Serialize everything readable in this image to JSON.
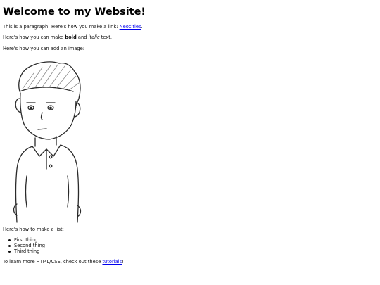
{
  "title": "Welcome to my Website!",
  "intro": {
    "before": "This is a paragraph! Here's how you make a link: ",
    "link": "Neocities",
    "after": "."
  },
  "formatting": {
    "before": "Here's how you can make ",
    "bold": "bold",
    "middle": " and ",
    "italic": "italic",
    "after": " text."
  },
  "image_intro": "Here's how you can add an image:",
  "image": {
    "alt": "cartoon-boy-drawing"
  },
  "list_intro": "Here's how to make a list:",
  "list": [
    "First thing",
    "Second thing",
    "Third thing"
  ],
  "outro": {
    "before": "To learn more HTML/CSS, check out these ",
    "link": "tutorials",
    "after": "!"
  },
  "colors": {
    "link": "#0000ee",
    "text": "#111111",
    "background": "#ffffff"
  }
}
